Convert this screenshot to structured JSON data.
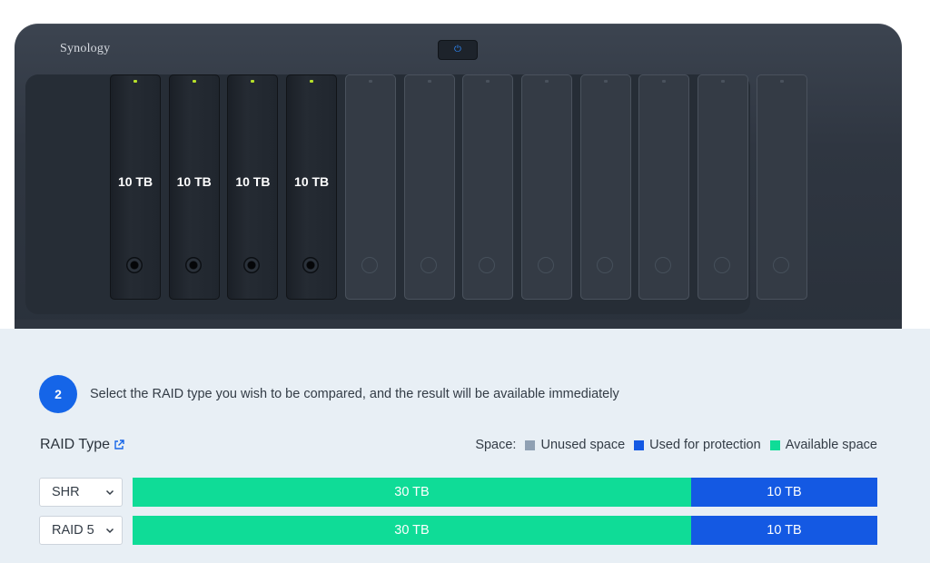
{
  "device": {
    "brand": "Synology",
    "bays": [
      {
        "capacity": "10 TB",
        "installed": true
      },
      {
        "capacity": "10 TB",
        "installed": true
      },
      {
        "capacity": "10 TB",
        "installed": true
      },
      {
        "capacity": "10 TB",
        "installed": true
      },
      {
        "capacity": "",
        "installed": false
      },
      {
        "capacity": "",
        "installed": false
      },
      {
        "capacity": "",
        "installed": false
      },
      {
        "capacity": "",
        "installed": false
      },
      {
        "capacity": "",
        "installed": false
      },
      {
        "capacity": "",
        "installed": false
      },
      {
        "capacity": "",
        "installed": false
      },
      {
        "capacity": "",
        "installed": false
      }
    ]
  },
  "step": {
    "number": "2",
    "text": "Select the RAID type you wish to be compared, and the result will be available immediately"
  },
  "raid_section": {
    "title": "RAID Type",
    "legend_label": "Space:",
    "legend": [
      {
        "label": "Unused space",
        "color": "#8fa0b3"
      },
      {
        "label": "Used for protection",
        "color": "#1459e3"
      },
      {
        "label": "Available space",
        "color": "#0fdc97"
      }
    ]
  },
  "rows": [
    {
      "raid": "SHR",
      "segments": [
        {
          "label": "30 TB",
          "type": "available",
          "value_tb": 30
        },
        {
          "label": "10 TB",
          "type": "protection",
          "value_tb": 10
        }
      ]
    },
    {
      "raid": "RAID 5",
      "segments": [
        {
          "label": "30 TB",
          "type": "available",
          "value_tb": 30
        },
        {
          "label": "10 TB",
          "type": "protection",
          "value_tb": 10
        }
      ]
    }
  ],
  "colors": {
    "available": "#0fdc97",
    "protection": "#1459e3",
    "unused": "#8fa0b3",
    "accent": "#1565e8"
  }
}
